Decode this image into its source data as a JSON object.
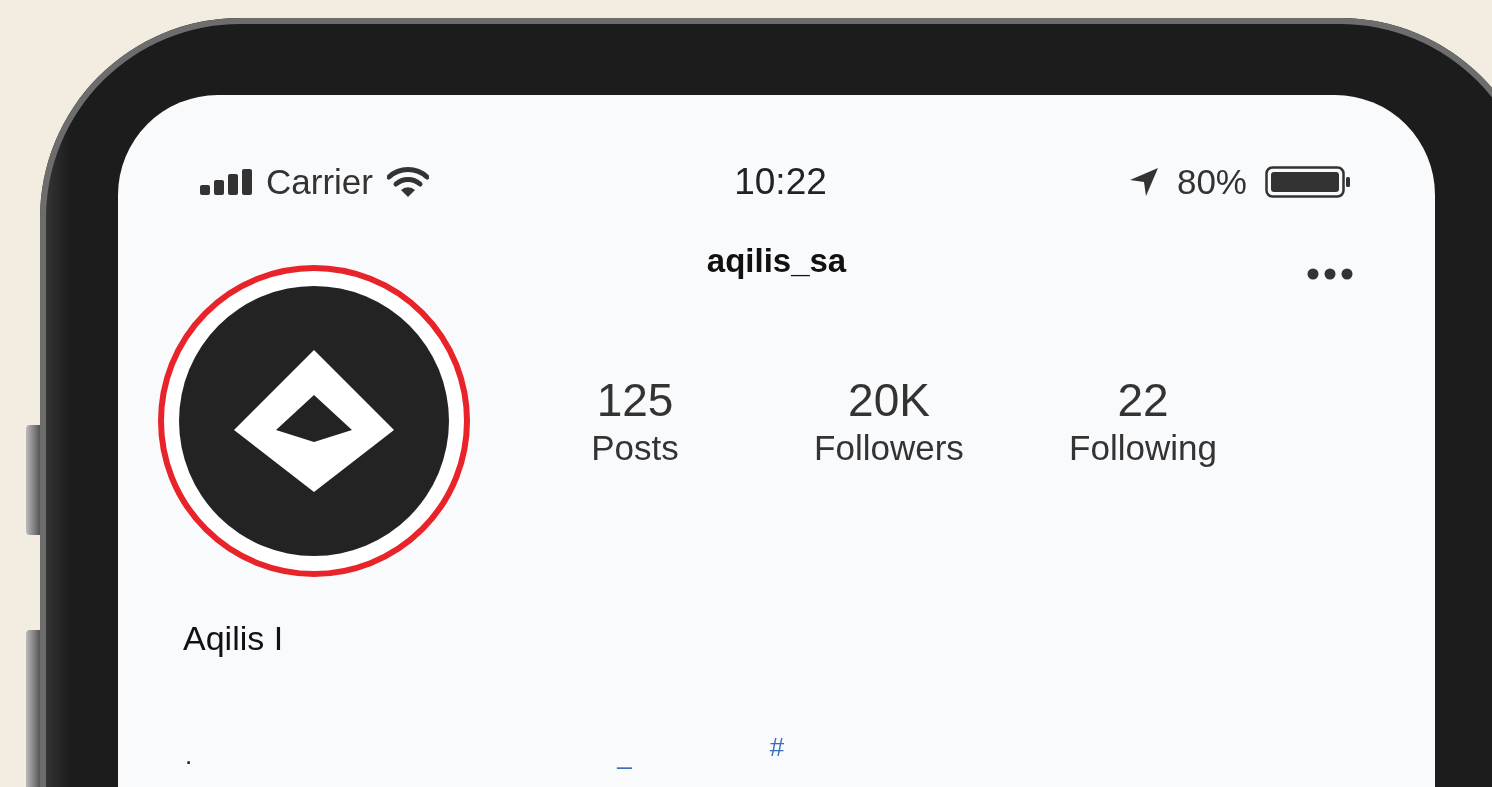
{
  "status_bar": {
    "carrier": "Carrier",
    "time": "10:22",
    "battery": "80%"
  },
  "header": {
    "username": "aqilis_sa"
  },
  "stats": [
    {
      "value": "125",
      "label": "Posts"
    },
    {
      "value": "20K",
      "label": "Followers"
    },
    {
      "value": "22",
      "label": "Following"
    }
  ],
  "profile": {
    "name": "Aqilis I"
  },
  "bio_fragments": [
    {
      "text": ".",
      "kind": "plain"
    },
    {
      "text": "_",
      "kind": "link"
    },
    {
      "text": "#",
      "kind": "link"
    }
  ]
}
